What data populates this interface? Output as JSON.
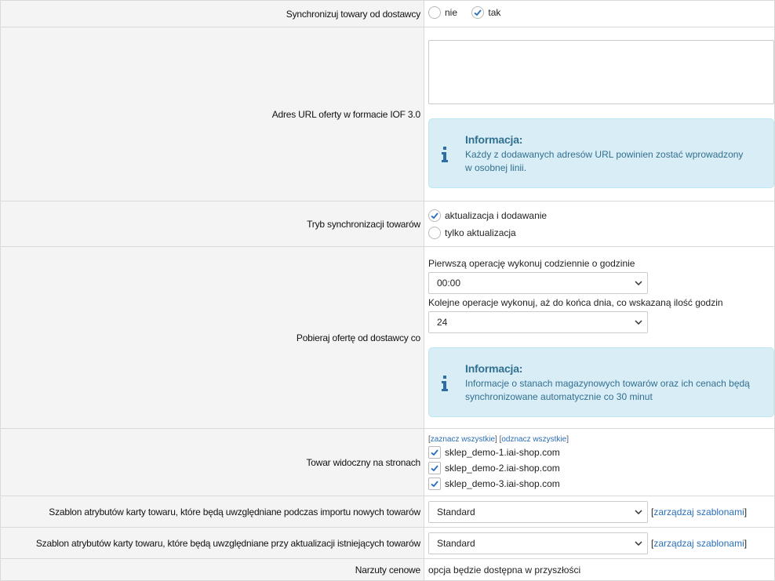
{
  "sync": {
    "label": "Synchronizuj towary od dostawcy",
    "options": [
      "nie",
      "tak"
    ],
    "selected": "tak"
  },
  "url": {
    "label": "Adres URL oferty w formacie IOF 3.0",
    "value": "",
    "info_title": "Informacja:",
    "info_text": "Każdy z dodawanych adresów URL powinien zostać wprowadzony w osobnej linii."
  },
  "mode": {
    "label": "Tryb synchronizacji towarów",
    "options": [
      "aktualizacja i dodawanie",
      "tylko aktualizacja"
    ],
    "selected": "aktualizacja i dodawanie"
  },
  "schedule": {
    "label": "Pobieraj ofertę od dostawcy co",
    "first_label": "Pierwszą operację wykonuj codziennie o godzinie",
    "first_value": "00:00",
    "next_label": "Kolejne operacje wykonuj, aż do końca dnia, co wskazaną ilość godzin",
    "next_value": "24",
    "info_title": "Informacja:",
    "info_text": "Informacje o stanach magazynowych towarów oraz ich cenach będą synchronizowane automatycznie co 30 minut"
  },
  "shops": {
    "label": "Towar widoczny na stronach",
    "select_all": "zaznacz wszystkie",
    "deselect_all": "odznacz wszystkie",
    "items": [
      "sklep_demo-1.iai-shop.com",
      "sklep_demo-2.iai-shop.com",
      "sklep_demo-3.iai-shop.com"
    ]
  },
  "template_new": {
    "label": "Szablon atrybutów karty towaru, które będą uwzględniane podczas importu nowych towarów",
    "value": "Standard",
    "manage": "zarządzaj szablonami"
  },
  "template_update": {
    "label": "Szablon atrybutów karty towaru, które będą uwzględniane przy aktualizacji istniejących towarów",
    "value": "Standard",
    "manage": "zarządzaj szablonami"
  },
  "markups": {
    "label": "Narzuty cenowe",
    "text": "opcja będzie dostępna w przyszłości"
  },
  "colors": {
    "check": "#2a6eb8",
    "info_bg": "#d9edf7",
    "info_text": "#31708f",
    "link": "#2a6eb8"
  }
}
